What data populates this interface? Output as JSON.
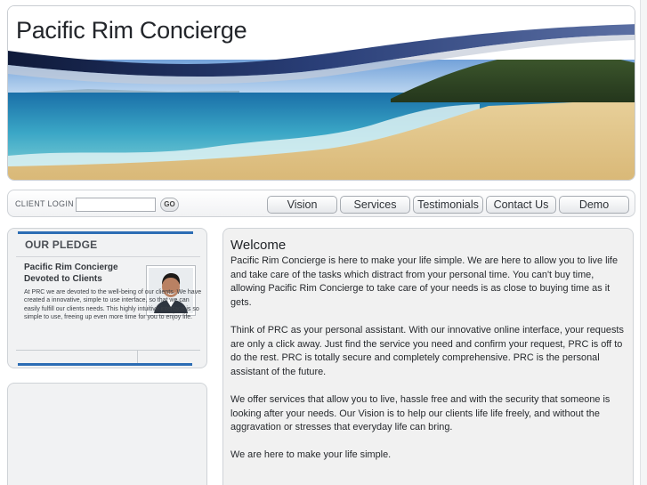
{
  "header": {
    "logo_part1": "Pacific Rim",
    "logo_part2": "Concierge"
  },
  "login": {
    "label": "CLIENT LOGIN",
    "input_value": "",
    "go_label": "GO"
  },
  "nav": {
    "items": [
      {
        "label": "Vision"
      },
      {
        "label": "Services"
      },
      {
        "label": "Testimonials"
      },
      {
        "label": "Contact Us"
      },
      {
        "label": "Demo"
      }
    ]
  },
  "pledge": {
    "title": "OUR PLEDGE",
    "subtitle": "Pacific Rim Concierge Devoted to Clients",
    "body": "At PRC we are devoted to the well-being of our clients. We have created a innovative, simple to use interface, so that we can easily fulfill our clients needs. This highly intuitive interface is so simple to use, freeing up even more time for you to enjoy life."
  },
  "main": {
    "title": "Welcome",
    "paragraphs": [
      "Pacific Rim Concierge is here to make your life simple. We are here to allow you to live life and take care of the tasks which distract from your personal time. You can't buy time, allowing Pacific Rim Concierge to take care of your needs is as close to buying time as it gets.",
      "Think of PRC as your personal assistant. With our innovative online interface, your requests are only a click away. Just find the service you need and confirm your request, PRC is off to do the rest. PRC is totally secure and completely comprehensive. PRC is the personal assistant of the future.",
      "We offer services that allow you to live, hassle free and with the security that someone is looking after your needs. Our Vision is to help our clients life life freely, and without the aggravation or stresses that everyday life can bring.",
      "We are here to make your life simple."
    ]
  },
  "colors": {
    "accent_blue": "#2c6db4",
    "swoosh_navy": "#1b2a55",
    "panel_bg": "#f1f2f3"
  }
}
